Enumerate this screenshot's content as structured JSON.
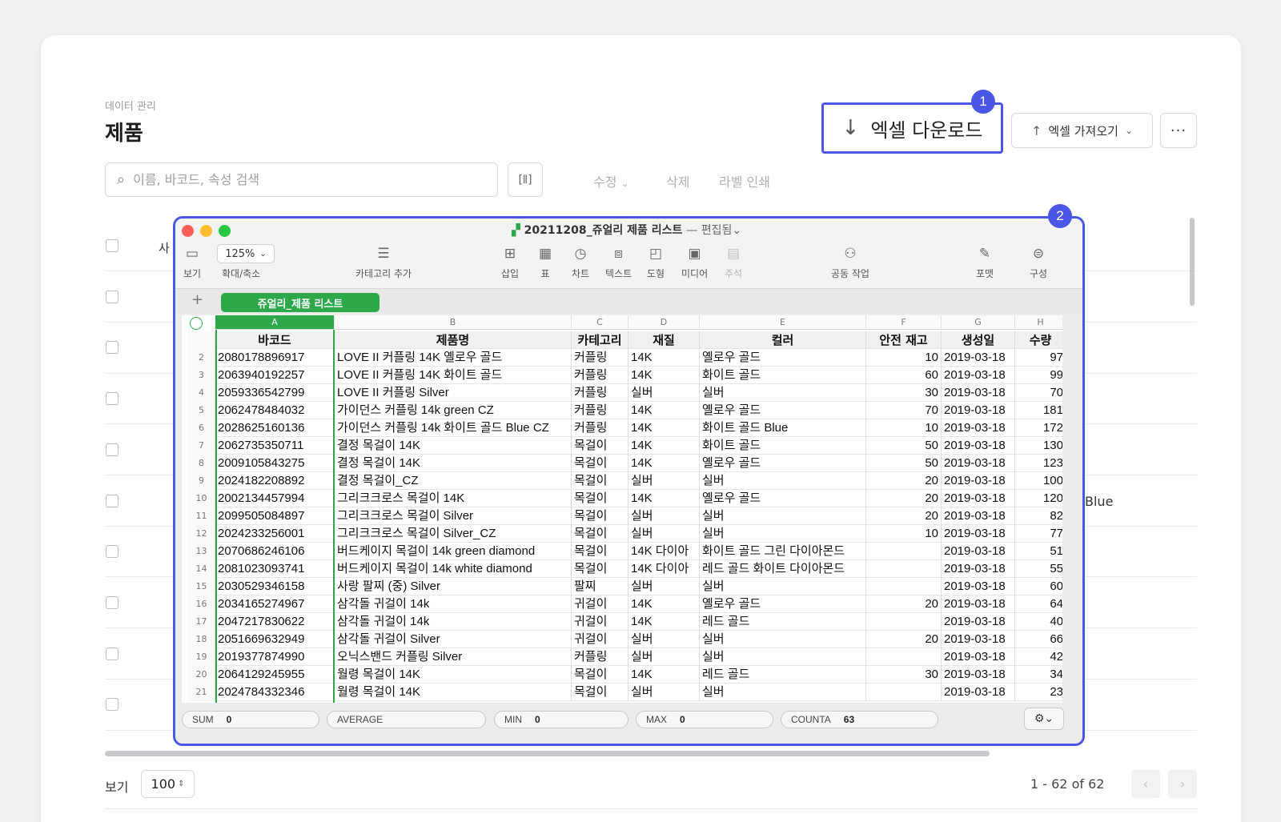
{
  "page": {
    "breadcrumb": "데이터 관리",
    "title": "제품",
    "download_label": "엑셀 다운로드",
    "import_label": "엑셀 가져오기",
    "more_label": "···",
    "badge1": "1",
    "badge2": "2",
    "search_placeholder": "이름, 바코드, 속성 검색",
    "actions": {
      "edit": "수정",
      "delete": "삭제",
      "print_label": "라벨 인쇄"
    },
    "bg_header_fragment": "사",
    "bg_text_fragment": "Blue",
    "view_label": "보기",
    "page_size": "100",
    "page_info": "1 - 62 of 62",
    "prev": "‹",
    "next": "›"
  },
  "sheet": {
    "file_name": "20211208_쥬얼리 제품 리스트",
    "file_status": "— 편집됨⌄",
    "zoom": "125%",
    "toolbar": [
      {
        "icon": "▭",
        "label": "보기"
      },
      {
        "icon": "",
        "label": "확대/축소"
      },
      {
        "icon": "☰",
        "label": "카테고리 추가"
      },
      {
        "icon": "⊞",
        "label": "삽입"
      },
      {
        "icon": "▦",
        "label": "표"
      },
      {
        "icon": "◷",
        "label": "차트"
      },
      {
        "icon": "⧈",
        "label": "텍스트"
      },
      {
        "icon": "◰",
        "label": "도형"
      },
      {
        "icon": "▣",
        "label": "미디어"
      },
      {
        "icon": "▤",
        "label": "주석"
      },
      {
        "icon": "⚇",
        "label": "공동 작업"
      },
      {
        "icon": "✎",
        "label": "포맷"
      },
      {
        "icon": "⊜",
        "label": "구성"
      }
    ],
    "tab_name": "쥬얼리_제품 리스트",
    "columns": [
      "A",
      "B",
      "C",
      "D",
      "E",
      "F",
      "G",
      "H"
    ],
    "headers": [
      "바코드",
      "제품명",
      "카테고리",
      "재질",
      "컬러",
      "안전 재고",
      "생성일",
      "수량"
    ],
    "rows": [
      [
        "2",
        "2080178896917",
        "LOVE II 커플링 14K 옐로우 골드",
        "커플링",
        "14K",
        "옐로우 골드",
        "10",
        "2019-03-18",
        "97"
      ],
      [
        "3",
        "2063940192257",
        "LOVE II 커플링 14K 화이트 골드",
        "커플링",
        "14K",
        "화이트 골드",
        "60",
        "2019-03-18",
        "99"
      ],
      [
        "4",
        "2059336542799",
        "LOVE II 커플링 Silver",
        "커플링",
        "실버",
        "실버",
        "30",
        "2019-03-18",
        "70"
      ],
      [
        "5",
        "2062478484032",
        "가이던스 커플링 14k green CZ",
        "커플링",
        "14K",
        "옐로우 골드",
        "70",
        "2019-03-18",
        "181"
      ],
      [
        "6",
        "2028625160136",
        "가이던스 커플링 14k 화이트 골드 Blue CZ",
        "커플링",
        "14K",
        "화이트 골드 Blue",
        "10",
        "2019-03-18",
        "172"
      ],
      [
        "7",
        "2062735350711",
        "결정 목걸이 14K",
        "목걸이",
        "14K",
        "화이트 골드",
        "50",
        "2019-03-18",
        "130"
      ],
      [
        "8",
        "2009105843275",
        "결정 목걸이 14K",
        "목걸이",
        "14K",
        "옐로우 골드",
        "50",
        "2019-03-18",
        "123"
      ],
      [
        "9",
        "2024182208892",
        "결정 목걸이_CZ",
        "목걸이",
        "실버",
        "실버",
        "20",
        "2019-03-18",
        "100"
      ],
      [
        "10",
        "2002134457994",
        "그리크크로스 목걸이 14K",
        "목걸이",
        "14K",
        "옐로우 골드",
        "20",
        "2019-03-18",
        "120"
      ],
      [
        "11",
        "2099505084897",
        "그리크크로스 목걸이 Silver",
        "목걸이",
        "실버",
        "실버",
        "20",
        "2019-03-18",
        "82"
      ],
      [
        "12",
        "2024233256001",
        "그리크크로스 목걸이 Silver_CZ",
        "목걸이",
        "실버",
        "실버",
        "10",
        "2019-03-18",
        "77"
      ],
      [
        "13",
        "2070686246106",
        "버드케이지 목걸이 14k green diamond",
        "목걸이",
        "14K 다이아",
        "화이트 골드 그린 다이아몬드",
        "",
        "2019-03-18",
        "51"
      ],
      [
        "14",
        "2081023093741",
        "버드케이지 목걸이 14k white diamond",
        "목걸이",
        "14K 다이아",
        "레드 골드 화이트 다이아몬드",
        "",
        "2019-03-18",
        "55"
      ],
      [
        "15",
        "2030529346158",
        "사랑 팔찌 (중) Silver",
        "팔찌",
        "실버",
        "실버",
        "",
        "2019-03-18",
        "60"
      ],
      [
        "16",
        "2034165274967",
        "삼각돌 귀걸이 14k",
        "귀걸이",
        "14K",
        "옐로우 골드",
        "20",
        "2019-03-18",
        "64"
      ],
      [
        "17",
        "2047217830622",
        "삼각돌 귀걸이 14k",
        "귀걸이",
        "14K",
        "레드 골드",
        "",
        "2019-03-18",
        "40"
      ],
      [
        "18",
        "2051669632949",
        "삼각돌 귀걸이 Silver",
        "귀걸이",
        "실버",
        "실버",
        "20",
        "2019-03-18",
        "66"
      ],
      [
        "19",
        "2019377874990",
        "오닉스밴드 커플링 Silver",
        "커플링",
        "실버",
        "실버",
        "",
        "2019-03-18",
        "42"
      ],
      [
        "20",
        "2064129245955",
        "월령 목걸이 14K",
        "목걸이",
        "14K",
        "레드 골드",
        "30",
        "2019-03-18",
        "34"
      ],
      [
        "21",
        "2024784332346",
        "월령 목걸이 14K",
        "목걸이",
        "실버",
        "실버",
        "",
        "2019-03-18",
        "23"
      ]
    ],
    "stats": [
      {
        "label": "SUM",
        "value": "0"
      },
      {
        "label": "AVERAGE",
        "value": ""
      },
      {
        "label": "MIN",
        "value": "0"
      },
      {
        "label": "MAX",
        "value": "0"
      },
      {
        "label": "COUNTA",
        "value": "63"
      }
    ],
    "gear": "⚙⌄"
  },
  "colors": {
    "accent": "#4a57e6",
    "sheet_green": "#2ca84a"
  }
}
